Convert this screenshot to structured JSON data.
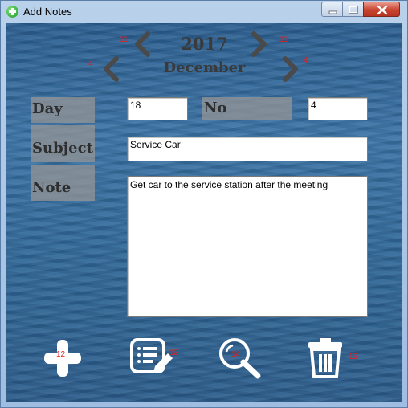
{
  "window": {
    "title": "Add Notes"
  },
  "nav": {
    "year": "2017",
    "month": "December",
    "prev_year_badge": "11",
    "next_year_badge": "11",
    "prev_month_badge": "4",
    "next_month_badge": "4"
  },
  "form": {
    "day_label": "Day",
    "day_value": "18",
    "no_label": "No",
    "no_value": "4",
    "subject_label": "Subject",
    "subject_value": "Service Car",
    "note_label": "Note",
    "note_value": "Get car to the service station after the meeting"
  },
  "toolbar": {
    "add_badge": "12",
    "list_badge": "13",
    "search_badge": "14",
    "delete_badge": "15"
  },
  "colors": {
    "label_bg": "#9a9a9a",
    "badge": "#e02020",
    "close_button": "#c8442f"
  }
}
